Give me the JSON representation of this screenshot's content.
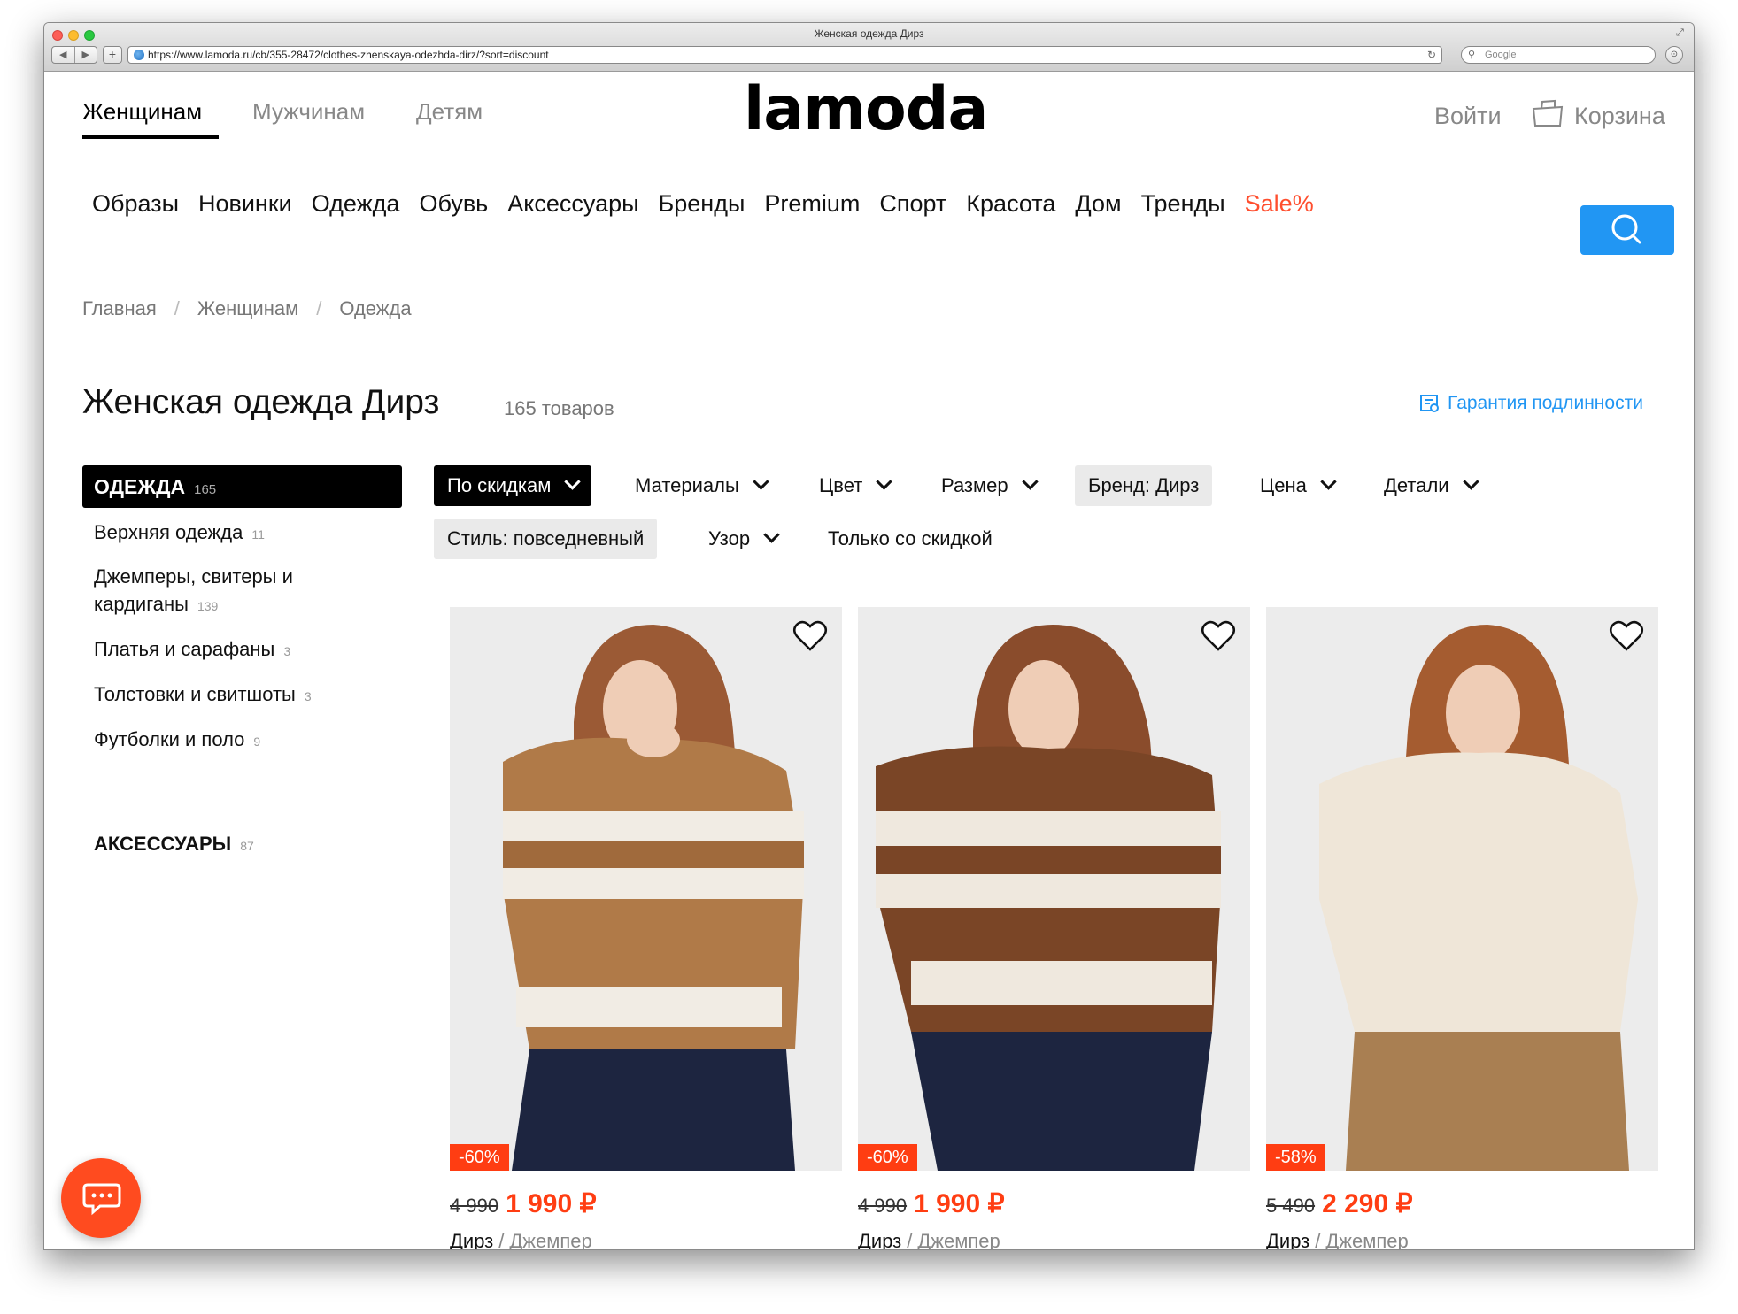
{
  "browser": {
    "window_title": "Женская одежда Дирз",
    "url": "https://www.lamoda.ru/cb/355-28472/clothes-zhenskaya-odezhda-dirz/?sort=discount",
    "search_placeholder": "Google",
    "nav_back": "◀",
    "nav_forward": "▶",
    "add_tab": "+",
    "reload": "↻"
  },
  "header": {
    "genders": [
      "Женщинам",
      "Мужчинам",
      "Детям"
    ],
    "logo": "lamoda",
    "login": "Войти",
    "cart": "Корзина"
  },
  "menu": [
    "Образы",
    "Новинки",
    "Одежда",
    "Обувь",
    "Аксессуары",
    "Бренды",
    "Premium",
    "Спорт",
    "Красота",
    "Дом",
    "Тренды",
    "Sale%"
  ],
  "breadcrumb": [
    "Главная",
    "Женщинам",
    "Одежда"
  ],
  "breadcrumb_sep": "/",
  "title": "Женская одежда Дирз",
  "count": "165 товаров",
  "guarantee": "Гарантия подлинности",
  "sidebar": {
    "head": {
      "label": "ОДЕЖДА",
      "count": "165"
    },
    "items": [
      {
        "label": "Верхняя одежда",
        "count": "11"
      },
      {
        "label": "Джемперы, свитеры и кардиганы",
        "count": "139"
      },
      {
        "label": "Платья и сарафаны",
        "count": "3"
      },
      {
        "label": "Толстовки и свитшоты",
        "count": "3"
      },
      {
        "label": "Футболки и поло",
        "count": "9"
      }
    ],
    "accessories": {
      "label": "АКСЕССУАРЫ",
      "count": "87"
    }
  },
  "filters": {
    "sort": "По скидкам",
    "materials": "Материалы",
    "color": "Цвет",
    "size": "Размер",
    "brand": "Бренд: Дирз",
    "price": "Цена",
    "details": "Детали",
    "style": "Стиль: повседневный",
    "pattern": "Узор",
    "discount_only": "Только со скидкой"
  },
  "products": [
    {
      "discount": "-60%",
      "old_price": "4 990",
      "new_price": "1 990 ₽",
      "brand": "Дирз",
      "type": "Джемпер"
    },
    {
      "discount": "-60%",
      "old_price": "4 990",
      "new_price": "1 990 ₽",
      "brand": "Дирз",
      "type": "Джемпер"
    },
    {
      "discount": "-58%",
      "old_price": "5 490",
      "new_price": "2 290 ₽",
      "brand": "Дирз",
      "type": "Джемпер"
    }
  ],
  "colors": {
    "accent": "#2196f3",
    "sale": "#ff4e2e",
    "discount_badge": "#ff3d12",
    "chat": "#ff4b1f"
  }
}
